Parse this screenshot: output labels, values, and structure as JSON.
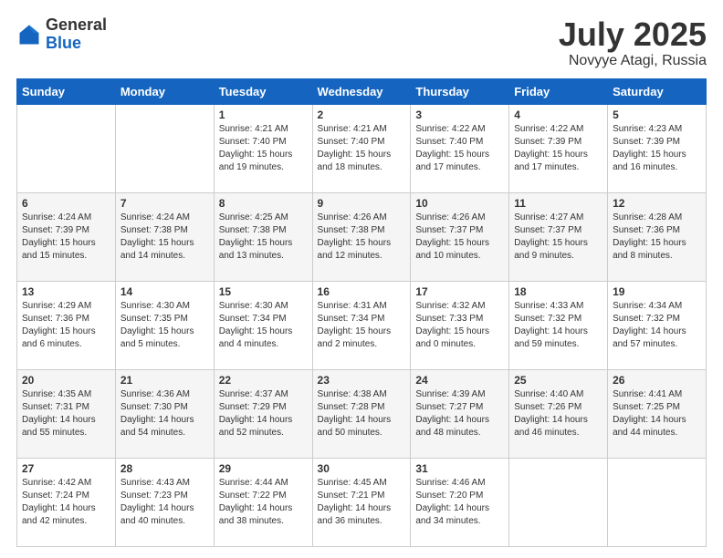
{
  "header": {
    "logo_general": "General",
    "logo_blue": "Blue",
    "month": "July 2025",
    "location": "Novyye Atagi, Russia"
  },
  "weekdays": [
    "Sunday",
    "Monday",
    "Tuesday",
    "Wednesday",
    "Thursday",
    "Friday",
    "Saturday"
  ],
  "weeks": [
    [
      {
        "day": "",
        "info": ""
      },
      {
        "day": "",
        "info": ""
      },
      {
        "day": "1",
        "info": "Sunrise: 4:21 AM\nSunset: 7:40 PM\nDaylight: 15 hours\nand 19 minutes."
      },
      {
        "day": "2",
        "info": "Sunrise: 4:21 AM\nSunset: 7:40 PM\nDaylight: 15 hours\nand 18 minutes."
      },
      {
        "day": "3",
        "info": "Sunrise: 4:22 AM\nSunset: 7:40 PM\nDaylight: 15 hours\nand 17 minutes."
      },
      {
        "day": "4",
        "info": "Sunrise: 4:22 AM\nSunset: 7:39 PM\nDaylight: 15 hours\nand 17 minutes."
      },
      {
        "day": "5",
        "info": "Sunrise: 4:23 AM\nSunset: 7:39 PM\nDaylight: 15 hours\nand 16 minutes."
      }
    ],
    [
      {
        "day": "6",
        "info": "Sunrise: 4:24 AM\nSunset: 7:39 PM\nDaylight: 15 hours\nand 15 minutes."
      },
      {
        "day": "7",
        "info": "Sunrise: 4:24 AM\nSunset: 7:38 PM\nDaylight: 15 hours\nand 14 minutes."
      },
      {
        "day": "8",
        "info": "Sunrise: 4:25 AM\nSunset: 7:38 PM\nDaylight: 15 hours\nand 13 minutes."
      },
      {
        "day": "9",
        "info": "Sunrise: 4:26 AM\nSunset: 7:38 PM\nDaylight: 15 hours\nand 12 minutes."
      },
      {
        "day": "10",
        "info": "Sunrise: 4:26 AM\nSunset: 7:37 PM\nDaylight: 15 hours\nand 10 minutes."
      },
      {
        "day": "11",
        "info": "Sunrise: 4:27 AM\nSunset: 7:37 PM\nDaylight: 15 hours\nand 9 minutes."
      },
      {
        "day": "12",
        "info": "Sunrise: 4:28 AM\nSunset: 7:36 PM\nDaylight: 15 hours\nand 8 minutes."
      }
    ],
    [
      {
        "day": "13",
        "info": "Sunrise: 4:29 AM\nSunset: 7:36 PM\nDaylight: 15 hours\nand 6 minutes."
      },
      {
        "day": "14",
        "info": "Sunrise: 4:30 AM\nSunset: 7:35 PM\nDaylight: 15 hours\nand 5 minutes."
      },
      {
        "day": "15",
        "info": "Sunrise: 4:30 AM\nSunset: 7:34 PM\nDaylight: 15 hours\nand 4 minutes."
      },
      {
        "day": "16",
        "info": "Sunrise: 4:31 AM\nSunset: 7:34 PM\nDaylight: 15 hours\nand 2 minutes."
      },
      {
        "day": "17",
        "info": "Sunrise: 4:32 AM\nSunset: 7:33 PM\nDaylight: 15 hours\nand 0 minutes."
      },
      {
        "day": "18",
        "info": "Sunrise: 4:33 AM\nSunset: 7:32 PM\nDaylight: 14 hours\nand 59 minutes."
      },
      {
        "day": "19",
        "info": "Sunrise: 4:34 AM\nSunset: 7:32 PM\nDaylight: 14 hours\nand 57 minutes."
      }
    ],
    [
      {
        "day": "20",
        "info": "Sunrise: 4:35 AM\nSunset: 7:31 PM\nDaylight: 14 hours\nand 55 minutes."
      },
      {
        "day": "21",
        "info": "Sunrise: 4:36 AM\nSunset: 7:30 PM\nDaylight: 14 hours\nand 54 minutes."
      },
      {
        "day": "22",
        "info": "Sunrise: 4:37 AM\nSunset: 7:29 PM\nDaylight: 14 hours\nand 52 minutes."
      },
      {
        "day": "23",
        "info": "Sunrise: 4:38 AM\nSunset: 7:28 PM\nDaylight: 14 hours\nand 50 minutes."
      },
      {
        "day": "24",
        "info": "Sunrise: 4:39 AM\nSunset: 7:27 PM\nDaylight: 14 hours\nand 48 minutes."
      },
      {
        "day": "25",
        "info": "Sunrise: 4:40 AM\nSunset: 7:26 PM\nDaylight: 14 hours\nand 46 minutes."
      },
      {
        "day": "26",
        "info": "Sunrise: 4:41 AM\nSunset: 7:25 PM\nDaylight: 14 hours\nand 44 minutes."
      }
    ],
    [
      {
        "day": "27",
        "info": "Sunrise: 4:42 AM\nSunset: 7:24 PM\nDaylight: 14 hours\nand 42 minutes."
      },
      {
        "day": "28",
        "info": "Sunrise: 4:43 AM\nSunset: 7:23 PM\nDaylight: 14 hours\nand 40 minutes."
      },
      {
        "day": "29",
        "info": "Sunrise: 4:44 AM\nSunset: 7:22 PM\nDaylight: 14 hours\nand 38 minutes."
      },
      {
        "day": "30",
        "info": "Sunrise: 4:45 AM\nSunset: 7:21 PM\nDaylight: 14 hours\nand 36 minutes."
      },
      {
        "day": "31",
        "info": "Sunrise: 4:46 AM\nSunset: 7:20 PM\nDaylight: 14 hours\nand 34 minutes."
      },
      {
        "day": "",
        "info": ""
      },
      {
        "day": "",
        "info": ""
      }
    ]
  ]
}
